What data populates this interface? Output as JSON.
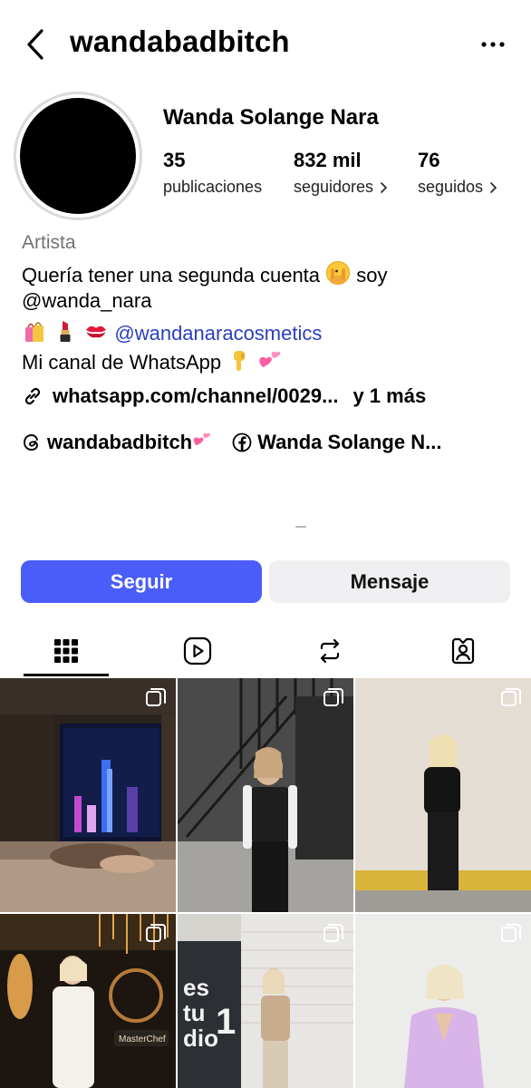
{
  "header": {
    "username": "wandabadbitch",
    "back_icon": "chevron-left-icon",
    "more_icon": "more-horizontal-icon"
  },
  "profile": {
    "display_name": "Wanda Solange Nara",
    "stats": [
      {
        "value": "35",
        "label": "publicaciones"
      },
      {
        "value": "832 mil",
        "label": "seguidores"
      },
      {
        "value": "76",
        "label": "seguidos"
      }
    ],
    "category": "Artista",
    "bio": {
      "line1": "Quería tener una segunda cuenta",
      "line1_end": "soy",
      "line2": "@wanda_nara",
      "line3_mention": "@wandanaracosmetics",
      "line4": "Mi canal de WhatsApp"
    },
    "link": {
      "text": "whatsapp.com/channel/0029...",
      "more": "y 1 más"
    },
    "social": [
      {
        "icon": "threads-icon",
        "label": "wandabadbitch"
      },
      {
        "icon": "facebook-icon",
        "label": "Wanda Solange N..."
      }
    ]
  },
  "actions": {
    "follow": "Seguir",
    "message": "Mensaje"
  },
  "tabs": [
    {
      "icon": "grid-icon",
      "active": true
    },
    {
      "icon": "reels-icon",
      "active": false
    },
    {
      "icon": "reposts-icon",
      "active": false
    },
    {
      "icon": "tagged-icon",
      "active": false
    }
  ],
  "colors": {
    "accent": "#4a5df9",
    "mention": "#2b3fbd",
    "secondary_text": "#737373",
    "button_secondary": "#efeff1"
  }
}
